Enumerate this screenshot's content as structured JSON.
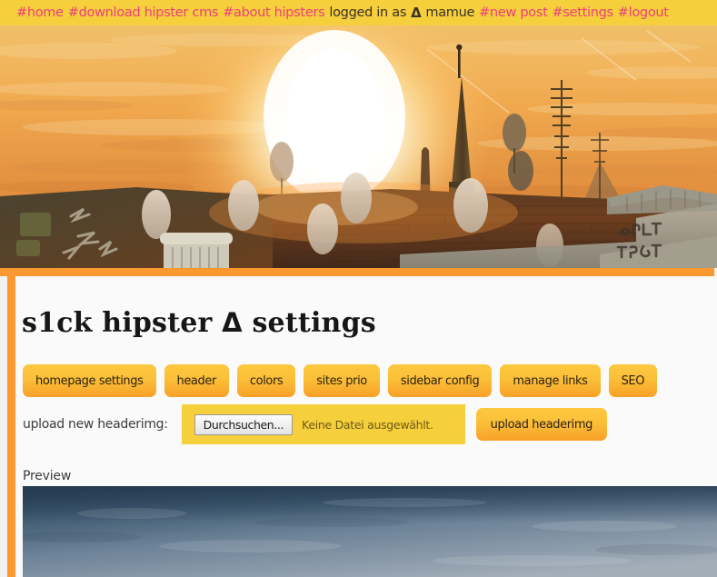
{
  "nav": {
    "items": [
      {
        "label": "#home",
        "type": "link",
        "name": "nav-home"
      },
      {
        "label": "#download hipster cms",
        "type": "link",
        "name": "nav-download-hipster-cms"
      },
      {
        "label": "#about hipsters",
        "type": "link",
        "name": "nav-about-hipsters"
      },
      {
        "label": "logged in as",
        "type": "text",
        "name": "nav-logged-in-as"
      },
      {
        "label": "Δ",
        "type": "delta",
        "name": "nav-delta-glyph"
      },
      {
        "label": "mamue",
        "type": "text",
        "name": "nav-username"
      },
      {
        "label": "#new post",
        "type": "link",
        "name": "nav-new-post"
      },
      {
        "label": "#settings",
        "type": "link",
        "name": "nav-settings"
      },
      {
        "label": "#logout",
        "type": "link",
        "name": "nav-logout"
      }
    ],
    "background_color": "#f6cf3c",
    "link_color": "#ef3f7c",
    "text_color": "#3a3228"
  },
  "banner": {
    "alt": "sunset over rooftops with satellite dishes and graffiti walls"
  },
  "page": {
    "title_part1": "s1ck hipster",
    "title_delta": "Δ",
    "title_part2": "settings",
    "accent_color": "#fb9830",
    "panel_color": "#fafafa"
  },
  "tabs": [
    {
      "label": "homepage settings",
      "name": "tab-homepage-settings"
    },
    {
      "label": "header",
      "name": "tab-header"
    },
    {
      "label": "colors",
      "name": "tab-colors"
    },
    {
      "label": "sites prio",
      "name": "tab-sites-prio"
    },
    {
      "label": "sidebar config",
      "name": "tab-sidebar-config"
    },
    {
      "label": "manage links",
      "name": "tab-manage-links"
    },
    {
      "label": "SEO",
      "name": "tab-seo"
    }
  ],
  "upload": {
    "label": "upload new headerimg:",
    "browse_button": "Durchsuchen...",
    "file_status": "Keine Datei ausgewählt.",
    "submit_button": "upload headerimg",
    "field_background": "#f6cf3c"
  },
  "preview": {
    "label": "Preview",
    "alt": "blue grey textured wall"
  }
}
